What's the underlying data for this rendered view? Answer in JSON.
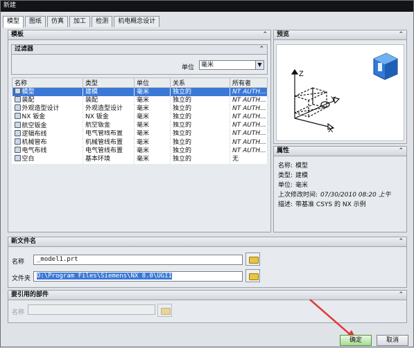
{
  "window": {
    "title": "新建"
  },
  "tabs": [
    {
      "label": "模型"
    },
    {
      "label": "图纸"
    },
    {
      "label": "仿真"
    },
    {
      "label": "加工"
    },
    {
      "label": "检测"
    },
    {
      "label": "机电概念设计"
    }
  ],
  "templates": {
    "header": "模板",
    "filter": {
      "header": "过滤器",
      "unit_label": "单位",
      "unit_value": "毫米"
    },
    "columns": [
      "名称",
      "类型",
      "单位",
      "关系",
      "所有者"
    ],
    "rows": [
      {
        "name": "模型",
        "type": "建模",
        "unit": "毫米",
        "relation": "独立的",
        "owner": "NT AUTH...",
        "selected": true
      },
      {
        "name": "装配",
        "type": "装配",
        "unit": "毫米",
        "relation": "独立的",
        "owner": "NT AUTH..."
      },
      {
        "name": "外观造型设计",
        "type": "外观造型设计",
        "unit": "毫米",
        "relation": "独立的",
        "owner": "NT AUTH..."
      },
      {
        "name": "NX 钣金",
        "type": "NX 钣金",
        "unit": "毫米",
        "relation": "独立的",
        "owner": "NT AUTH..."
      },
      {
        "name": "航空钣金",
        "type": "航空钣金",
        "unit": "毫米",
        "relation": "独立的",
        "owner": "NT AUTH..."
      },
      {
        "name": "逻辑布线",
        "type": "电气管线布置",
        "unit": "毫米",
        "relation": "独立的",
        "owner": "NT AUTH..."
      },
      {
        "name": "机械管布",
        "type": "机械管线布置",
        "unit": "毫米",
        "relation": "独立的",
        "owner": "NT AUTH..."
      },
      {
        "name": "电气布线",
        "type": "电气管线布置",
        "unit": "毫米",
        "relation": "独立的",
        "owner": "NT AUTH..."
      },
      {
        "name": "空白",
        "type": "基本环境",
        "unit": "毫米",
        "relation": "独立的",
        "owner": "无"
      }
    ]
  },
  "preview": {
    "header": "预览",
    "axis_z": "Z",
    "axis_y": "Y",
    "axis_x": "X"
  },
  "properties": {
    "header": "属性",
    "items": [
      {
        "label": "名称:",
        "value": "模型"
      },
      {
        "label": "类型:",
        "value": "建模"
      },
      {
        "label": "单位:",
        "value": "毫米"
      },
      {
        "label": "上次修改时间:",
        "value": "07/30/2010 08:20 上午"
      },
      {
        "label": "描述:",
        "value": "带基准 CSYS 的 NX 示例"
      }
    ]
  },
  "new_file": {
    "header": "新文件名",
    "name_label": "名称",
    "name_value": "_model1.prt",
    "folder_label": "文件夹",
    "folder_value": "D:\\Program Files\\Siemens\\NX 8.0\\UGII"
  },
  "referenced": {
    "header": "要引用的部件",
    "name_label": "名称",
    "name_value": ""
  },
  "buttons": {
    "ok": "确定",
    "cancel": "取消"
  },
  "colors": {
    "selection": "#3a78d6",
    "arrow": "#e03a3a",
    "cube": "#2f7ad8"
  }
}
